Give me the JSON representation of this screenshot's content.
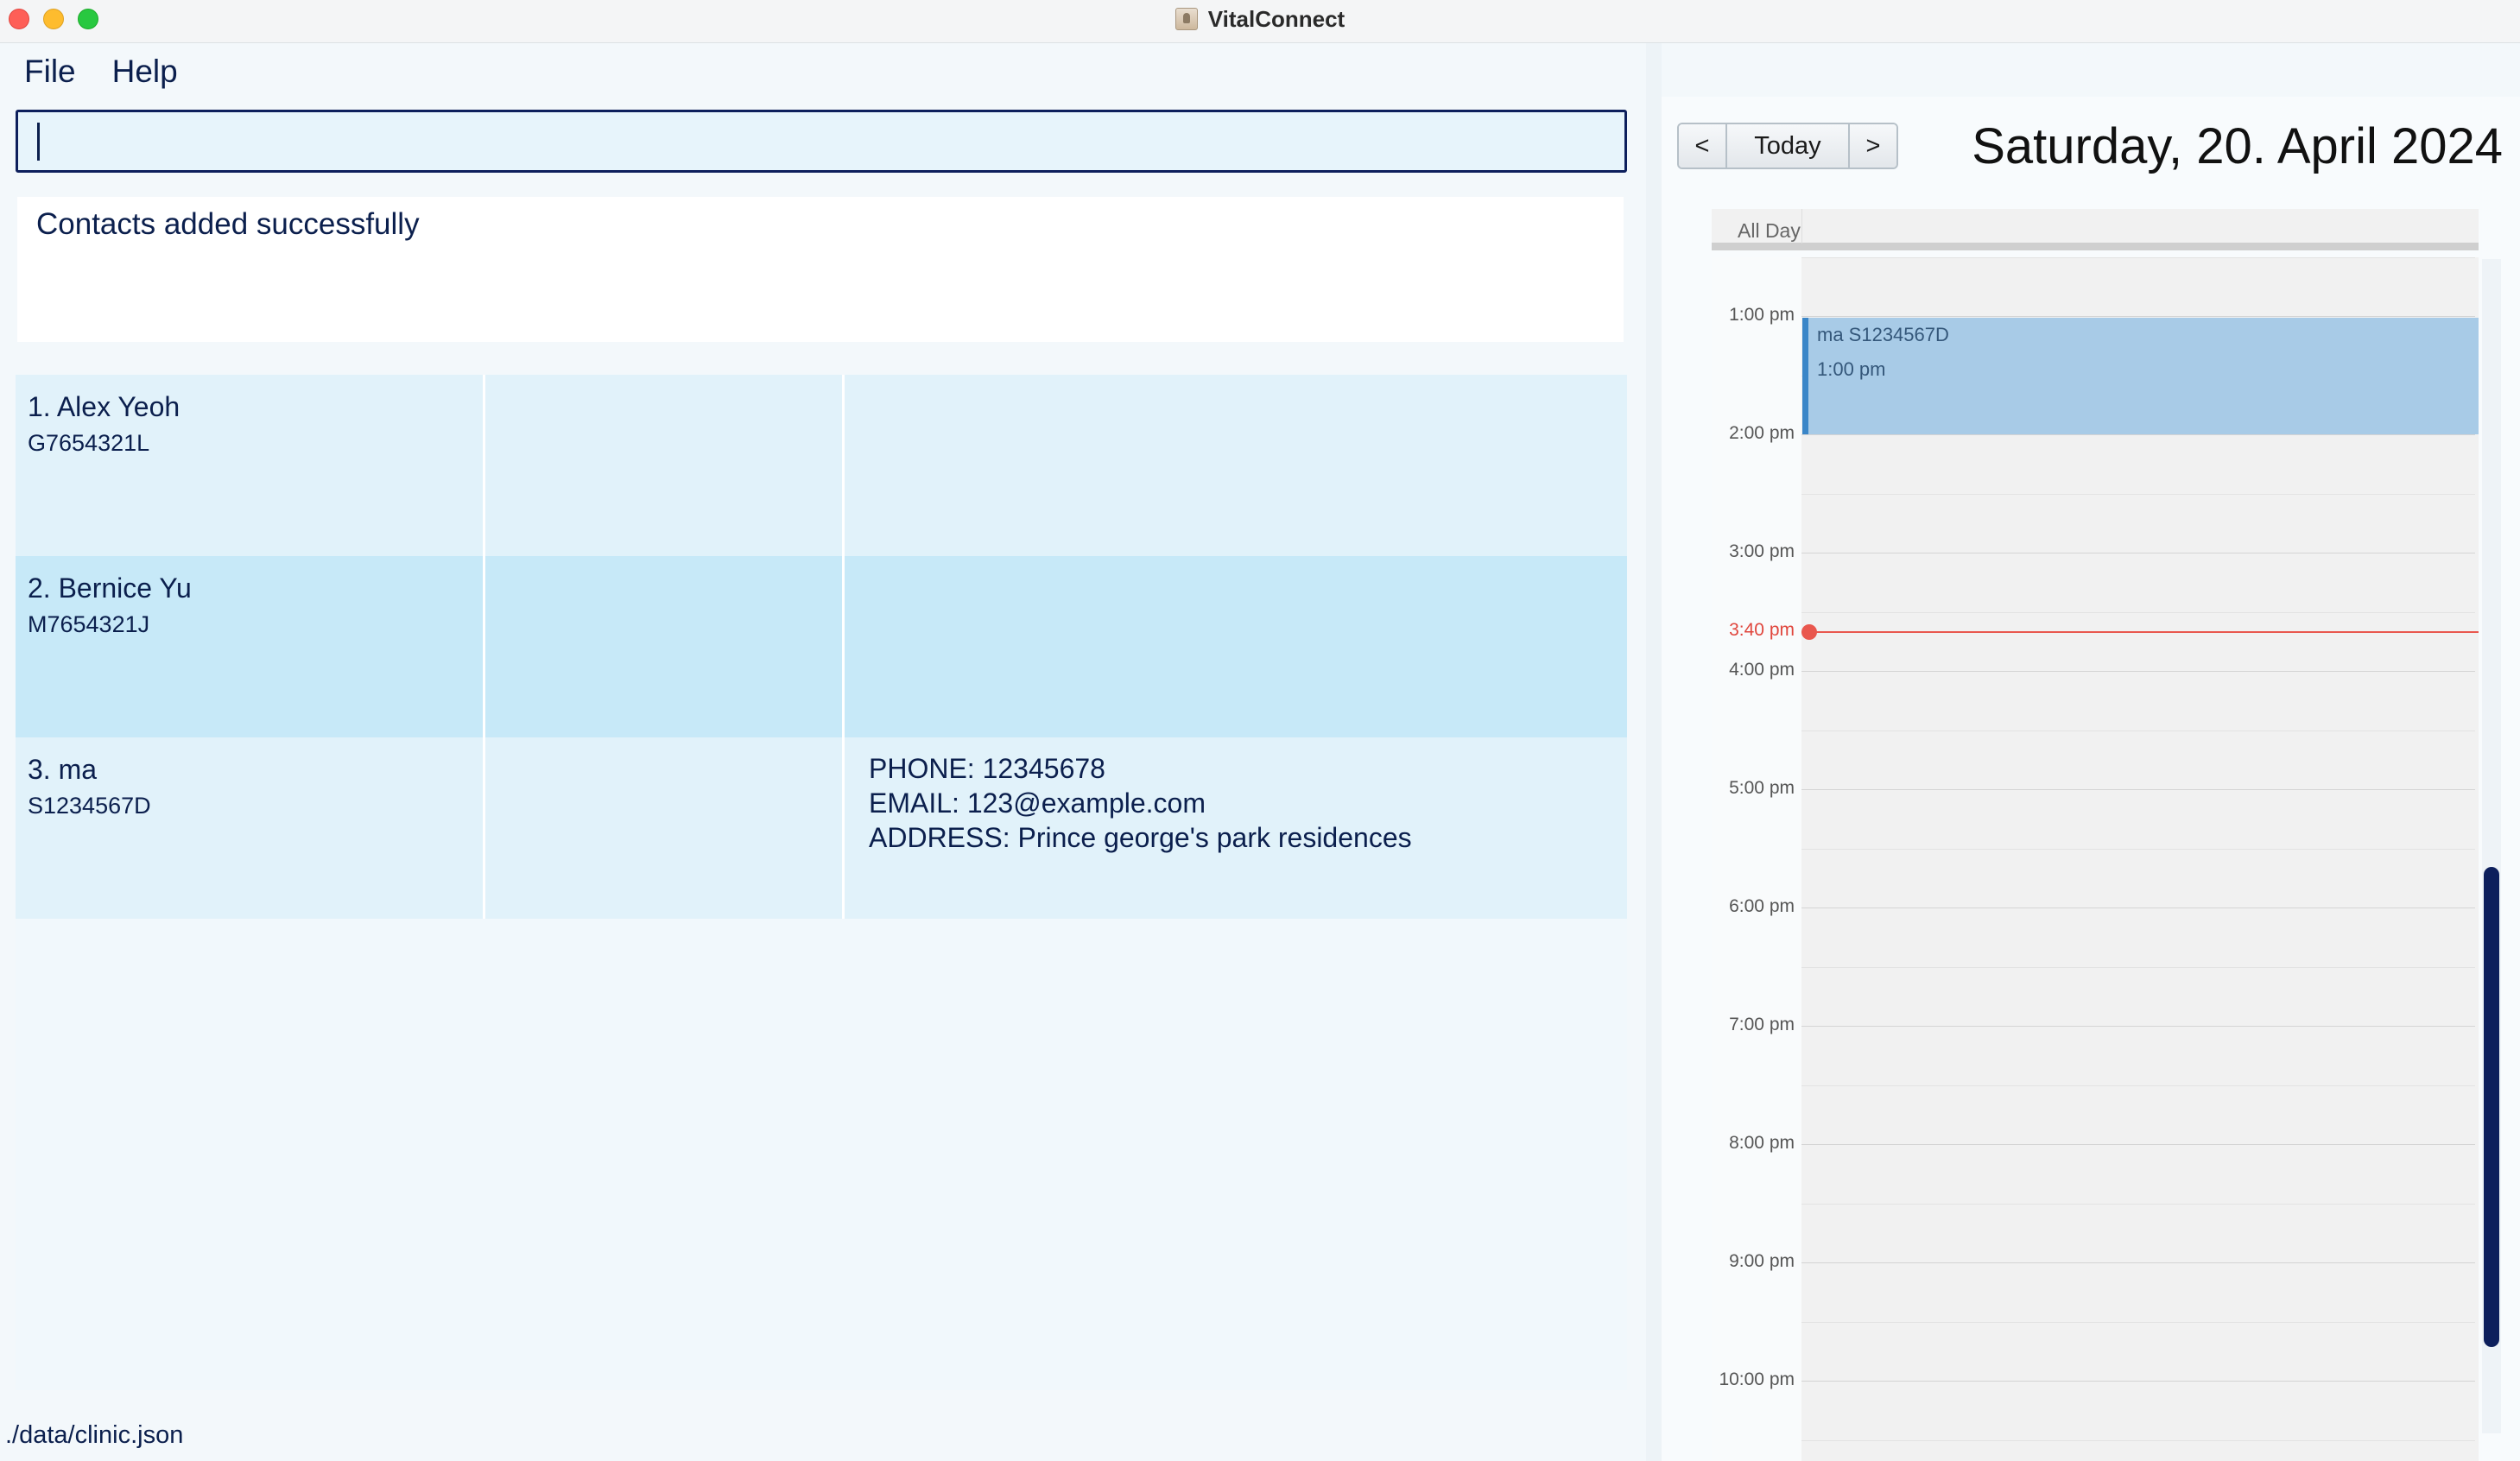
{
  "window": {
    "title": "VitalConnect"
  },
  "menu": {
    "items": [
      {
        "label": "File"
      },
      {
        "label": "Help"
      }
    ]
  },
  "command": {
    "value": "",
    "placeholder": ""
  },
  "result": {
    "message": "Contacts added successfully"
  },
  "contacts": [
    {
      "name": "1. Alex Yeoh",
      "nric": "G7654321L",
      "info": []
    },
    {
      "name": "2. Bernice Yu",
      "nric": "M7654321J",
      "info": []
    },
    {
      "name": "3. ma",
      "nric": "S1234567D",
      "info": [
        "PHONE: 12345678",
        "EMAIL: 123@example.com",
        "ADDRESS: Prince george's park residences"
      ]
    }
  ],
  "status": {
    "file_path": "./data/clinic.json"
  },
  "calendar": {
    "nav": {
      "prev": "<",
      "today": "Today",
      "next": ">"
    },
    "date_title": "Saturday, 20. April 2024",
    "all_day_label": "All Day",
    "hours": [
      "1:00 pm",
      "2:00 pm",
      "3:00 pm",
      "4:00 pm",
      "5:00 pm",
      "6:00 pm",
      "7:00 pm",
      "8:00 pm",
      "9:00 pm",
      "10:00 pm"
    ],
    "current_time": "3:40 pm",
    "events": [
      {
        "title": "ma S1234567D",
        "time": "1:00 pm"
      }
    ]
  },
  "colors": {
    "accent": "#0d1f5c",
    "row_odd": "#e1f2fa",
    "row_even": "#c7e9f8",
    "event_bg": "#a8cbe7",
    "now_line": "#e9574e"
  }
}
